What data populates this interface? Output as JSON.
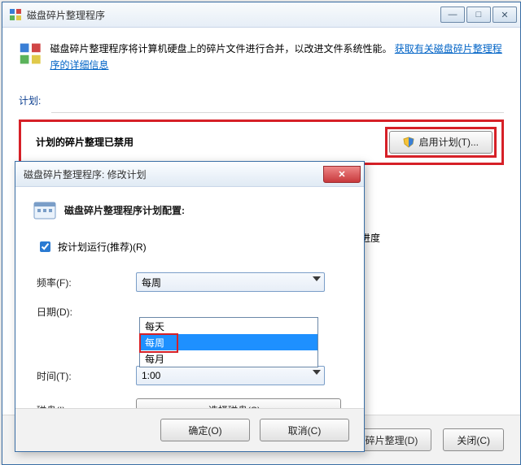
{
  "main": {
    "title": "磁盘碎片整理程序",
    "intro_text_before_link": "磁盘碎片整理程序将计算机硬盘上的碎片文件进行合并，以改进文件系统性能。",
    "intro_link": "获取有关磁盘碎片整理程序的详细信息",
    "sched_section": "计划:",
    "sched_disabled": "计划的碎片整理已禁用",
    "enable_btn": "启用计划(T)...",
    "progress_label": "进度",
    "defrag_btn": "磁盘碎片整理(D)",
    "close_btn": "关闭(C)"
  },
  "dialog": {
    "title": "磁盘碎片整理程序: 修改计划",
    "cfg_head": "磁盘碎片整理程序计划配置:",
    "run_chk": "按计划运行(推荐)(R)",
    "freq_label": "频率(F):",
    "freq_value": "每周",
    "date_label": "日期(D):",
    "time_label": "时间(T):",
    "time_value": "1:00",
    "disk_label": "磁盘(I):",
    "disk_btn": "选择磁盘(S)...",
    "ok_btn": "确定(O)",
    "cancel_btn": "取消(C)",
    "dd_options": {
      "opt0": "每天",
      "opt1": "每周",
      "opt2": "每月"
    }
  }
}
